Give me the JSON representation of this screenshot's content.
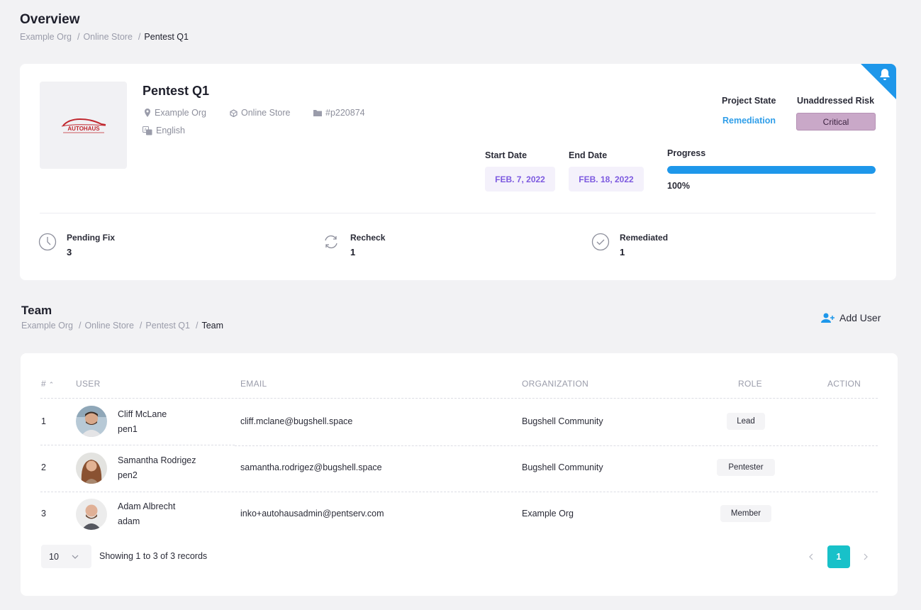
{
  "overview": {
    "title": "Overview",
    "breadcrumb": [
      "Example Org",
      "Online Store",
      "Pentest Q1"
    ]
  },
  "project": {
    "name": "Pentest Q1",
    "org": "Example Org",
    "asset": "Online Store",
    "id": "#p220874",
    "language": "English",
    "logo_text": "AUTOHAUS",
    "state_label": "Project State",
    "state": "Remediation",
    "risk_label": "Unaddressed Risk",
    "risk": "Critical",
    "start_label": "Start Date",
    "start": "FEB. 7, 2022",
    "end_label": "End Date",
    "end": "FEB. 18, 2022",
    "progress_label": "Progress",
    "progress": 100,
    "progress_text": "100%",
    "stats": [
      {
        "label": "Pending Fix",
        "value": "3"
      },
      {
        "label": "Recheck",
        "value": "1"
      },
      {
        "label": "Remediated",
        "value": "1"
      }
    ]
  },
  "team": {
    "title": "Team",
    "breadcrumb": [
      "Example Org",
      "Online Store",
      "Pentest Q1",
      "Team"
    ],
    "add_user": "Add User",
    "columns": {
      "num": "#",
      "user": "USER",
      "email": "EMAIL",
      "org": "ORGANIZATION",
      "role": "ROLE",
      "action": "ACTION"
    },
    "rows": [
      {
        "num": "1",
        "name": "Cliff McLane",
        "login": "pen1",
        "email": "cliff.mclane@bugshell.space",
        "org": "Bugshell Community",
        "role": "Lead"
      },
      {
        "num": "2",
        "name": "Samantha Rodrigez",
        "login": "pen2",
        "email": "samantha.rodrigez@bugshell.space",
        "org": "Bugshell Community",
        "role": "Pentester"
      },
      {
        "num": "3",
        "name": "Adam Albrecht",
        "login": "adam",
        "email": "inko+autohausadmin@pentserv.com",
        "org": "Example Org",
        "role": "Member"
      }
    ],
    "page_size": "10",
    "records_text": "Showing 1 to 3 of 3 records",
    "current_page": "1"
  },
  "colors": {
    "accent": "#1e97ea",
    "risk_critical": "#c9a8c8",
    "page_active": "#18c1c9",
    "date_text": "#7d5ae0"
  }
}
